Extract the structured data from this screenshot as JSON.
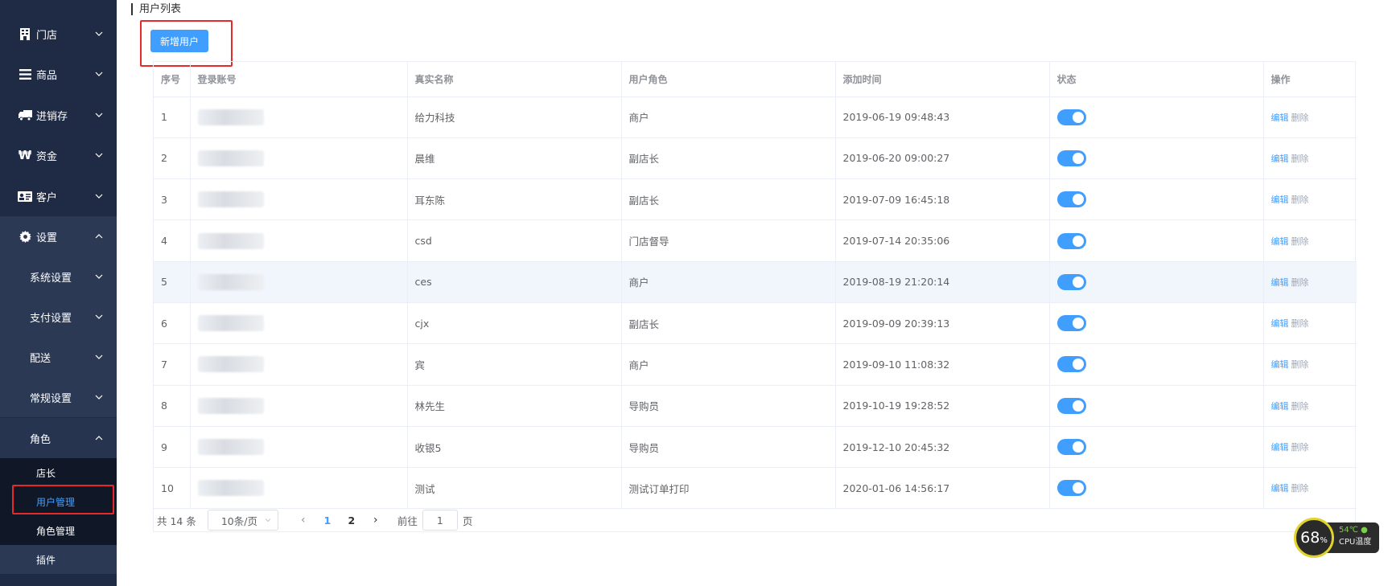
{
  "sidebar": {
    "menus": [
      {
        "label": "门店",
        "icon": "building-icon"
      },
      {
        "label": "商品",
        "icon": "list-icon"
      },
      {
        "label": "进销存",
        "icon": "truck-icon"
      },
      {
        "label": "资金",
        "icon": "won-icon"
      },
      {
        "label": "客户",
        "icon": "id-card-icon"
      },
      {
        "label": "设置",
        "icon": "gear-icon"
      }
    ],
    "settings_submenus": [
      "系统设置",
      "支付设置",
      "配送",
      "常规设置",
      "角色"
    ],
    "role_items": [
      "店长",
      "用户管理",
      "角色管理",
      "插件"
    ]
  },
  "main": {
    "title": "用户列表",
    "add_button": "新增用户",
    "columns": [
      "序号",
      "登录账号",
      "真实名称",
      "用户角色",
      "添加时间",
      "状态",
      "操作"
    ],
    "rows": [
      {
        "no": "1",
        "name": "给力科技",
        "role": "商户",
        "time": "2019-06-19 09:48:43"
      },
      {
        "no": "2",
        "name": "晨维",
        "role": "副店长",
        "time": "2019-06-20 09:00:27"
      },
      {
        "no": "3",
        "name": "耳东陈",
        "role": "副店长",
        "time": "2019-07-09 16:45:18"
      },
      {
        "no": "4",
        "name": "csd",
        "role": "门店督导",
        "time": "2019-07-14 20:35:06"
      },
      {
        "no": "5",
        "name": "ces",
        "role": "商户",
        "time": "2019-08-19 21:20:14"
      },
      {
        "no": "6",
        "name": "cjx",
        "role": "副店长",
        "time": "2019-09-09 20:39:13"
      },
      {
        "no": "7",
        "name": "宾",
        "role": "商户",
        "time": "2019-09-10 11:08:32"
      },
      {
        "no": "8",
        "name": "林先生",
        "role": "导购员",
        "time": "2019-10-19 19:28:52"
      },
      {
        "no": "9",
        "name": "收银5",
        "role": "导购员",
        "time": "2019-12-10 20:45:32"
      },
      {
        "no": "10",
        "name": "测试",
        "role": "测试订单打印",
        "time": "2020-01-06 14:56:17"
      }
    ],
    "status_on": true,
    "actions": {
      "edit": "编辑",
      "delete": "删除"
    }
  },
  "pagination": {
    "total": "共 14 条",
    "page_size": "10条/页",
    "pages": [
      "1",
      "2"
    ],
    "current_page": "1",
    "goto_prefix": "前往",
    "goto_value": "1",
    "goto_suffix": "页"
  },
  "cpu_widget": {
    "usage": "68",
    "unit": "%",
    "temperature": "54℃",
    "label": "CPU温度"
  },
  "colors": {
    "sidebar": "#1f2a44",
    "accent": "#409eff",
    "highlight": "#e62a2a"
  }
}
